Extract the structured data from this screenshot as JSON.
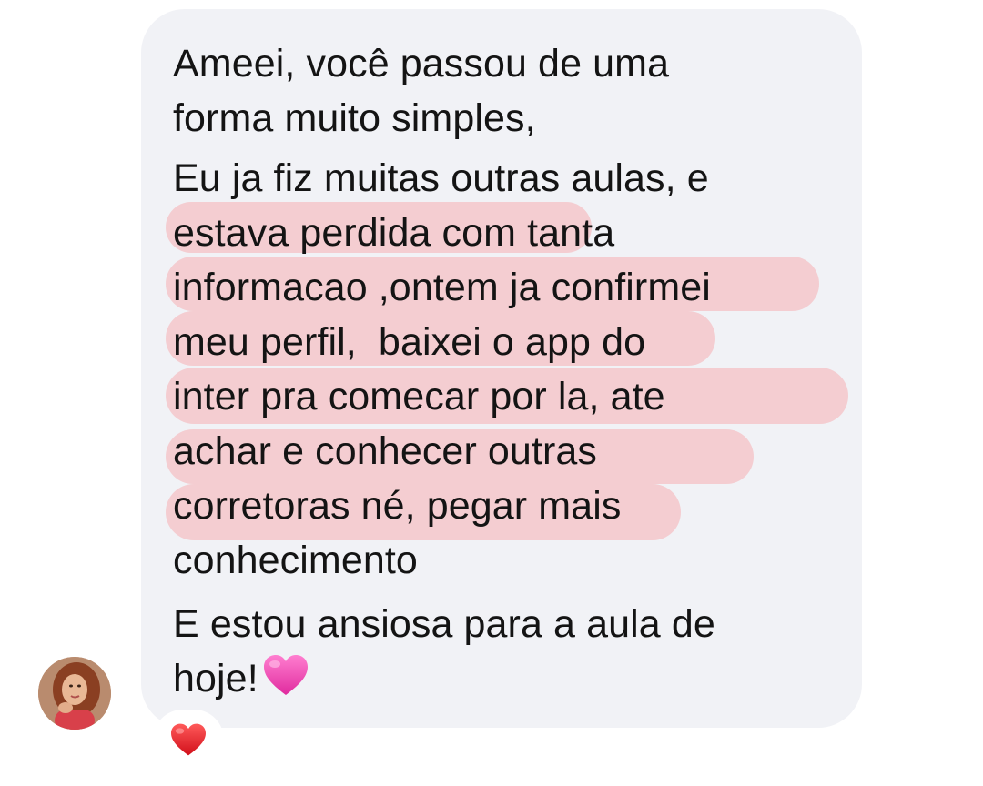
{
  "message": {
    "lines": [
      "Ameei, você passou de uma",
      "forma muito simples,",
      "Eu ja fiz muitas outras aulas, e",
      "estava perdida com tanta",
      "informacao ,ontem ja confirmei",
      "meu perfil,  baixei o app do",
      "inter pra comecar por la, ate",
      "achar e conhecer outras",
      "corretoras né, pegar mais",
      "conhecimento",
      "E estou ansiosa para a aula de",
      "hoje!"
    ],
    "trailing_emoji": "pink-heart-emoji",
    "highlight_color": "#f4c4c8"
  },
  "reaction": {
    "emoji": "red-heart-emoji"
  },
  "sender": {
    "avatar": "profile-photo"
  }
}
